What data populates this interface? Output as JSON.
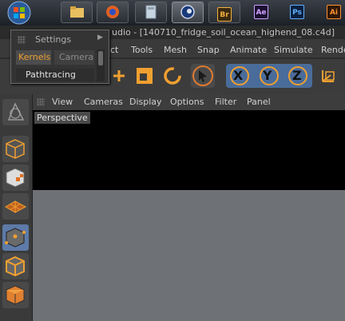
{
  "taskbar": {
    "apps": [
      {
        "icon": "folder-icon"
      },
      {
        "icon": "firefox-icon"
      },
      {
        "icon": "calculator-icon"
      },
      {
        "icon": "cinema4d-icon"
      },
      {
        "label": "Br",
        "color": "#f0b040"
      },
      {
        "label": "Ae",
        "color": "#d0a0ff"
      },
      {
        "label": "Ps",
        "color": "#60b0ff"
      },
      {
        "label": "Ai",
        "color": "#ff9030"
      }
    ]
  },
  "window": {
    "title_visible": "udio - [140710_fridge_soil_ocean_highend_08.c4d]"
  },
  "mainmenu": {
    "items": [
      "ct",
      "Tools",
      "Mesh",
      "Snap",
      "Animate",
      "Simulate",
      "Rende"
    ]
  },
  "toolbar": {
    "axis": [
      "X",
      "Y",
      "Z"
    ]
  },
  "viewport": {
    "menu": [
      "View",
      "Cameras",
      "Display",
      "Options",
      "Filter",
      "Panel"
    ],
    "label": "Perspective"
  },
  "popup": {
    "title": "Settings",
    "tabs": [
      "Kernels",
      "CameraIn"
    ],
    "item": "Pathtracing"
  },
  "colors": {
    "accent": "#f0a030",
    "selection": "#5d7aa8"
  }
}
